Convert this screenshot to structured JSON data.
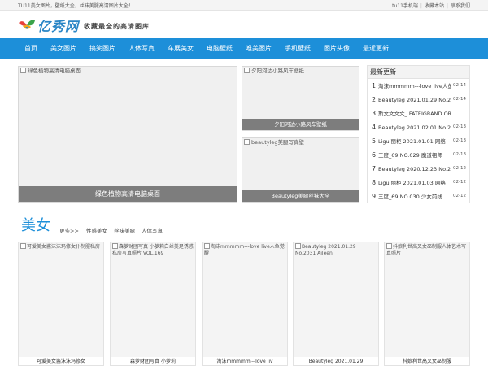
{
  "topbar": {
    "notice": "TU11美女图片，壁纸大全，丝袜美腿高清图片大全！",
    "links": [
      "tu11手机端",
      "收藏本站",
      "联系我们"
    ]
  },
  "logo": {
    "brand": "亿秀网",
    "slogan": "收藏最全的高清图库"
  },
  "nav": [
    "首页",
    "美女图片",
    "搞笑图片",
    "人体写真",
    "车展美女",
    "电脑壁纸",
    "唯美图片",
    "手机壁纸",
    "图片头像",
    "最近更新"
  ],
  "featured": {
    "hero": {
      "alt": "绿色植物高清电脑桌面",
      "caption": "绿色植物高清电脑桌面"
    },
    "side1": {
      "alt": "夕阳河边小路风车壁纸",
      "caption": "夕阳河边小路风车壁纸"
    },
    "side2": {
      "alt": "beautyleg美腿写真壁",
      "caption": "Beautyleg美腿丝袜大全"
    }
  },
  "latest": {
    "title": "最新更新",
    "items": [
      {
        "num": "1",
        "title": "淘沫mmmmm---love live人鱼",
        "date": "02-14"
      },
      {
        "num": "2",
        "title": "Beautyleg 2021.01.29 No.2",
        "date": "02-14"
      },
      {
        "num": "3",
        "title": "斯文文文文_ FATEIGRAND OR",
        "date": ""
      },
      {
        "num": "4",
        "title": "Beautyleg 2021.02.01 No.2",
        "date": "02-13"
      },
      {
        "num": "5",
        "title": "Ligui丽柜 2021.01.01 网络",
        "date": "02-13"
      },
      {
        "num": "6",
        "title": "三度_69 NO.029 魔道祖师",
        "date": "02-13"
      },
      {
        "num": "7",
        "title": "Beautyleg 2020.12.23 No.2",
        "date": "02-12"
      },
      {
        "num": "8",
        "title": "Ligui丽柜 2021.01.03 网络",
        "date": "02-12"
      },
      {
        "num": "9",
        "title": "三度_69 NO.030 少女前线",
        "date": "02-12"
      }
    ]
  },
  "section": {
    "title": "美女",
    "more": "更多>>",
    "subs": [
      "性感美女",
      "丝袜美腿",
      "人体写真"
    ]
  },
  "cards": [
    {
      "alt": "可爱美女酱沫沫玛修女仆制服私房",
      "title": "可爱美女酱沫沫玛修女"
    },
    {
      "alt": "森萝财团写真 小萝莉白丝美足诱惑私房写真照片 VOL.169",
      "title": "森萝财团写真 小萝莉"
    },
    {
      "alt": "淘沫mmmmm---love live人鱼觉醒",
      "title": "淘沫mmmmm---love liv"
    },
    {
      "alt": "Beautyleg 2021.01.29 No.2031 Aileen",
      "title": "Beautyleg 2021.01.29"
    },
    {
      "alt": "抖娘利世高叉女巫制服人体艺术写真照片",
      "title": "抖娘利世高叉女巫制服"
    }
  ]
}
